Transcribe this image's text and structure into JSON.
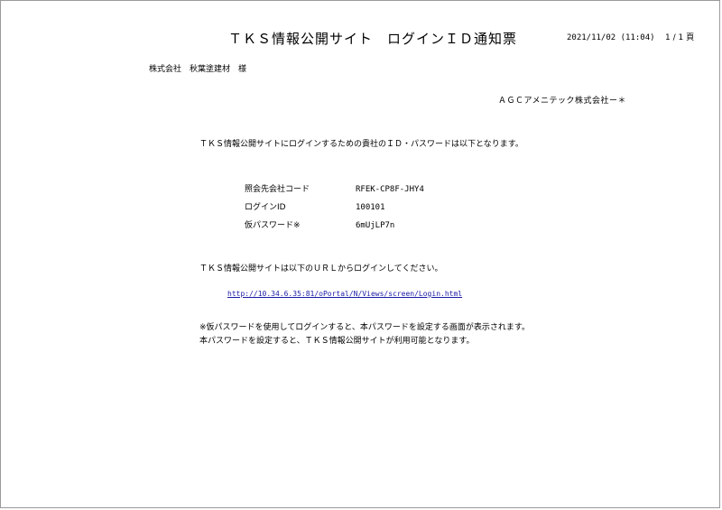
{
  "header": {
    "title": "ＴＫＳ情報公開サイト　ログインＩＤ通知票",
    "date": "2021/11/02 (11:04)",
    "page": "1 / 1 頁"
  },
  "recipient": "株式会社　秋葉塗建材　様",
  "sender": "ＡＧＣアメニテック株式会社ー＊",
  "intro": "ＴＫＳ情報公開サイトにログインするための貴社のＩＤ・パスワードは以下となります。",
  "credentials": [
    {
      "label": "照会先会社コード",
      "value": "RFEK-CP8F-JHY4"
    },
    {
      "label": "ログインID",
      "value": "100101"
    },
    {
      "label": "仮パスワード※",
      "value": "6mUjLP7n"
    }
  ],
  "login": {
    "intro": "ＴＫＳ情報公開サイトは以下のＵＲＬからログインしてください。",
    "url": "http://10.34.6.35:81/oPortal/N/Views/screen/Login.html"
  },
  "notes": [
    "※仮パスワードを使用してログインすると、本パスワードを設定する画面が表示されます。",
    "本パスワードを設定すると、ＴＫＳ情報公開サイトが利用可能となります。"
  ]
}
